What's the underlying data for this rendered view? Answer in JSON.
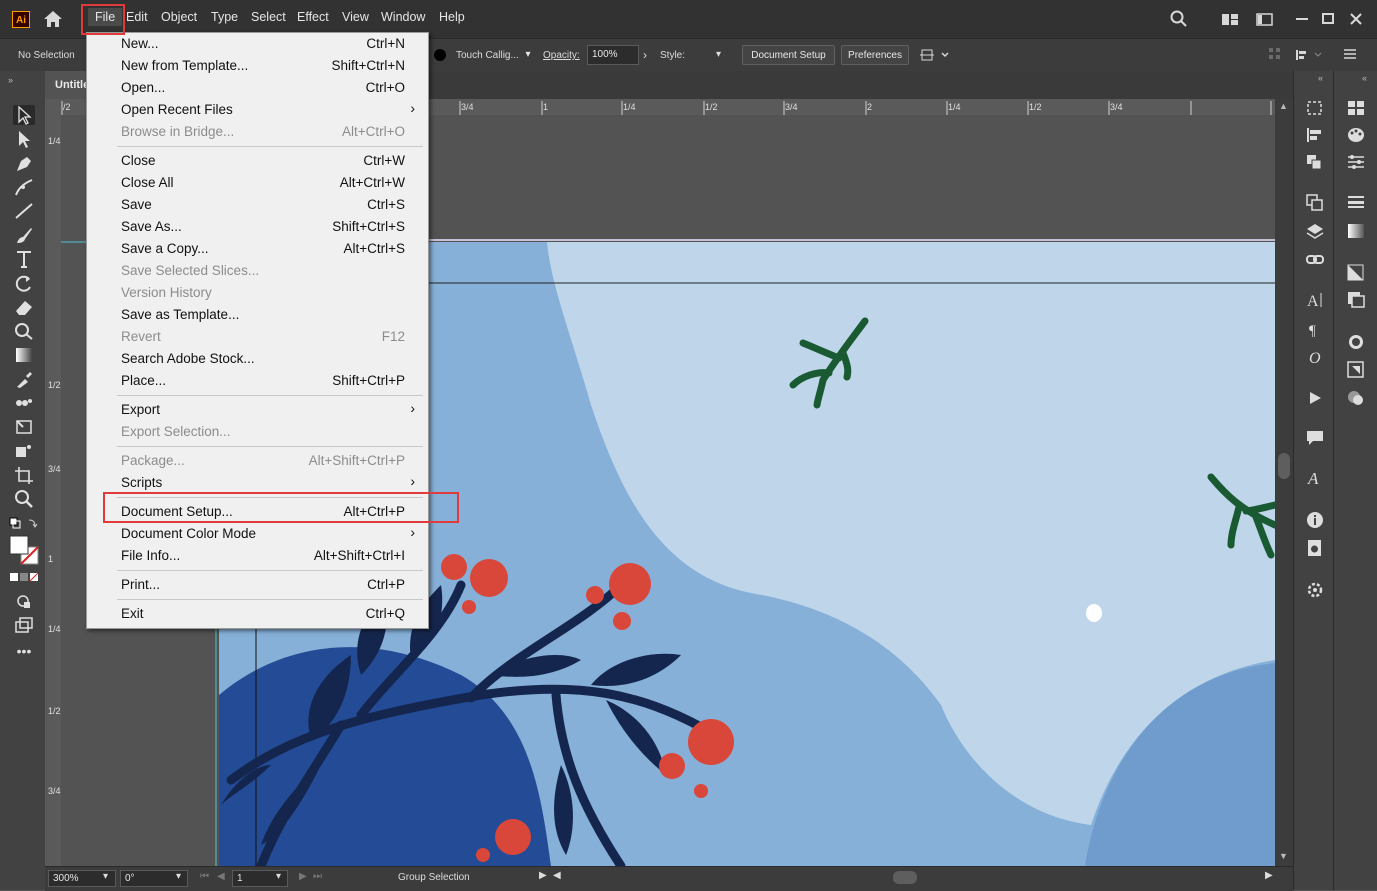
{
  "app": {
    "logo": "Ai",
    "doc_tab": "Untitle"
  },
  "menubar": [
    "File",
    "Edit",
    "Object",
    "Type",
    "Select",
    "Effect",
    "View",
    "Window",
    "Help"
  ],
  "controlbar": {
    "selection": "No Selection",
    "brush": "Touch Callig...",
    "opacity_label": "Opacity:",
    "opacity_value": "100%",
    "style_label": "Style:",
    "document_setup": "Document Setup",
    "preferences": "Preferences"
  },
  "ruler_h": [
    "/2",
    "3/4",
    "1",
    "1/4",
    "1/2",
    "3/4",
    "2",
    "1/4",
    "1/2",
    "3/4"
  ],
  "ruler_v": [
    "1/4",
    "1/2",
    "3/4",
    "1",
    "1/4",
    "1/2",
    "3/4"
  ],
  "file_menu": [
    {
      "label": "New...",
      "shortcut": "Ctrl+N"
    },
    {
      "label": "New from Template...",
      "shortcut": "Shift+Ctrl+N"
    },
    {
      "label": "Open...",
      "shortcut": "Ctrl+O"
    },
    {
      "label": "Open Recent Files",
      "shortcut": "",
      "submenu": true
    },
    {
      "label": "Browse in Bridge...",
      "shortcut": "Alt+Ctrl+O",
      "disabled": true
    },
    {
      "sep": true
    },
    {
      "label": "Close",
      "shortcut": "Ctrl+W"
    },
    {
      "label": "Close All",
      "shortcut": "Alt+Ctrl+W"
    },
    {
      "label": "Save",
      "shortcut": "Ctrl+S"
    },
    {
      "label": "Save As...",
      "shortcut": "Shift+Ctrl+S"
    },
    {
      "label": "Save a Copy...",
      "shortcut": "Alt+Ctrl+S"
    },
    {
      "label": "Save Selected Slices...",
      "shortcut": "",
      "disabled": true
    },
    {
      "label": "Version History",
      "shortcut": "",
      "disabled": true
    },
    {
      "label": "Save as Template...",
      "shortcut": ""
    },
    {
      "label": "Revert",
      "shortcut": "F12",
      "disabled": true
    },
    {
      "label": "Search Adobe Stock...",
      "shortcut": ""
    },
    {
      "label": "Place...",
      "shortcut": "Shift+Ctrl+P"
    },
    {
      "sep": true
    },
    {
      "label": "Export",
      "shortcut": "",
      "submenu": true
    },
    {
      "label": "Export Selection...",
      "shortcut": "",
      "disabled": true
    },
    {
      "sep": true
    },
    {
      "label": "Package...",
      "shortcut": "Alt+Shift+Ctrl+P",
      "disabled": true
    },
    {
      "label": "Scripts",
      "shortcut": "",
      "submenu": true
    },
    {
      "sep": true
    },
    {
      "label": "Document Setup...",
      "shortcut": "Alt+Ctrl+P",
      "highlighted": true
    },
    {
      "label": "Document Color Mode",
      "shortcut": "",
      "submenu": true
    },
    {
      "label": "File Info...",
      "shortcut": "Alt+Shift+Ctrl+I"
    },
    {
      "sep": true
    },
    {
      "label": "Print...",
      "shortcut": "Ctrl+P"
    },
    {
      "sep": true
    },
    {
      "label": "Exit",
      "shortcut": "Ctrl+Q"
    }
  ],
  "statusbar": {
    "zoom": "300%",
    "rotation": "0°",
    "artboard": "1",
    "tool": "Group Selection"
  },
  "colors": {
    "highlight_box": "#e03a3a",
    "sky_light": "#bed5ea",
    "sky_mid": "#86b0d8",
    "hill_dark": "#234b96",
    "branch_navy": "#15264e",
    "berry_red": "#d9473a",
    "leaf_green": "#1a5a32"
  }
}
